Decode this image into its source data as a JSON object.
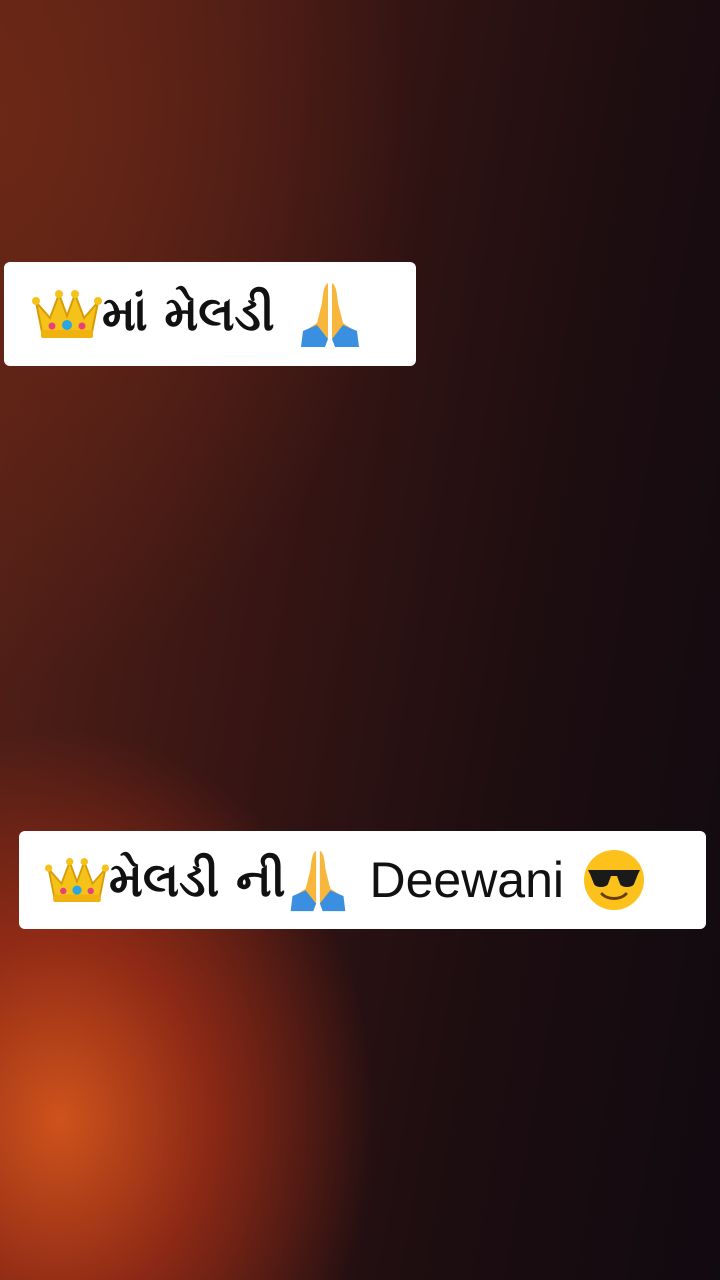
{
  "captions": [
    {
      "text": "માં મેલડી",
      "icons": [
        "crown-icon",
        "folded-hands-icon"
      ]
    },
    {
      "text": "મેલડી ની",
      "latin_text": "Deewani",
      "icons": [
        "crown-icon",
        "folded-hands-icon",
        "sunglasses-smiley-icon"
      ]
    }
  ]
}
